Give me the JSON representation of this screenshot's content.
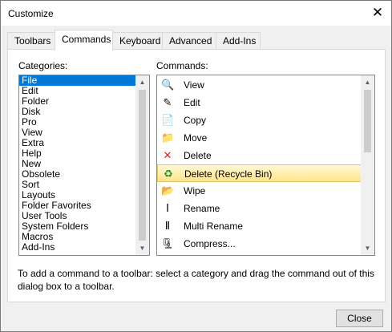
{
  "window": {
    "title": "Customize",
    "close_glyph": "✕"
  },
  "tabs": [
    {
      "label": "Toolbars"
    },
    {
      "label": "Commands"
    },
    {
      "label": "Keyboard"
    },
    {
      "label": "Advanced"
    },
    {
      "label": "Add-Ins"
    }
  ],
  "active_tab": "Commands",
  "categories": {
    "label": "Categories:",
    "selected": "File",
    "items": [
      "File",
      "Edit",
      "Folder",
      "Disk",
      "Pro",
      "View",
      "Extra",
      "Help",
      "New",
      "Obsolete",
      "Sort",
      "Layouts",
      "Folder Favorites",
      "User Tools",
      "System Folders",
      "Macros",
      "Add-Ins"
    ]
  },
  "commands": {
    "label": "Commands:",
    "highlighted": "Delete (Recycle Bin)",
    "items": [
      {
        "label": "View",
        "icon": "view-icon",
        "glyph": "🔍"
      },
      {
        "label": "Edit",
        "icon": "edit-icon",
        "glyph": "✎"
      },
      {
        "label": "Copy",
        "icon": "copy-icon",
        "glyph": "📄"
      },
      {
        "label": "Move",
        "icon": "move-icon",
        "glyph": "📁"
      },
      {
        "label": "Delete",
        "icon": "delete-icon",
        "glyph": "✕"
      },
      {
        "label": "Delete (Recycle Bin)",
        "icon": "recycle-bin-icon",
        "glyph": "♻"
      },
      {
        "label": "Wipe",
        "icon": "wipe-icon",
        "glyph": "📂"
      },
      {
        "label": "Rename",
        "icon": "rename-icon",
        "glyph": "Ⅰ"
      },
      {
        "label": "Multi Rename",
        "icon": "multi-rename-icon",
        "glyph": "Ⅱ"
      },
      {
        "label": "Compress...",
        "icon": "compress-icon",
        "glyph": "🗜"
      }
    ]
  },
  "help_text": "To add a command to a toolbar: select a category and drag the command out of this dialog box to a toolbar.",
  "buttons": {
    "close": "Close"
  },
  "colors": {
    "selection": "#0078d7",
    "highlight": "#ffe58a",
    "delete_red": "#e02020"
  }
}
